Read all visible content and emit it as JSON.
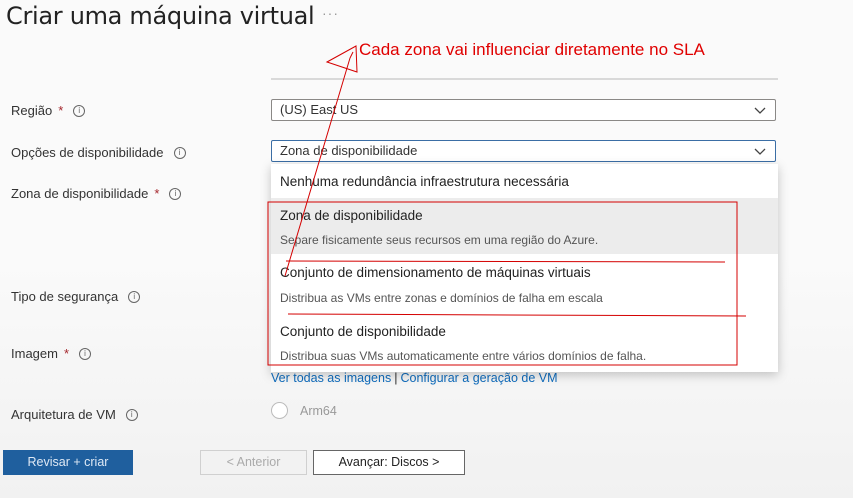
{
  "page_title": "Criar uma máquina virtual",
  "title_menu": "···",
  "annotation": "Cada zona vai influenciar diretamente no SLA",
  "fields": {
    "regiao": {
      "label": "Região",
      "required": "*",
      "value": "(US) East US"
    },
    "opcoes": {
      "label": "Opções de disponibilidade",
      "value": "Zona de disponibilidade"
    },
    "zona": {
      "label": "Zona de disponibilidade",
      "required": "*"
    },
    "tipo_seguranca": {
      "label": "Tipo de segurança"
    },
    "imagem": {
      "label": "Imagem",
      "required": "*"
    },
    "arquitetura": {
      "label": "Arquitetura de VM"
    }
  },
  "dropdown": {
    "items": [
      {
        "title": "Nenhuma redundância infraestrutura necessária",
        "desc": ""
      },
      {
        "title": "Zona de disponibilidade",
        "desc": "Separe fisicamente seus recursos em uma região do Azure."
      },
      {
        "title": "Conjunto de dimensionamento de máquinas virtuais",
        "desc": "Distribua as VMs entre zonas e domínios de falha em escala"
      },
      {
        "title": "Conjunto de disponibilidade",
        "desc": "Distribua suas VMs automaticamente entre vários domínios de falha."
      }
    ]
  },
  "image_links": {
    "see_all": "Ver todas as imagens",
    "separator": "|",
    "configure": "Configurar a geração de VM"
  },
  "architecture_option": "Arm64",
  "buttons": {
    "review": "Revisar + criar",
    "previous": "< Anterior",
    "next": "Avançar: Discos >"
  },
  "info_glyph": "i",
  "colors": {
    "annotation": "#e00000",
    "primary": "#1f5f9e",
    "link": "#0f6cbd"
  }
}
